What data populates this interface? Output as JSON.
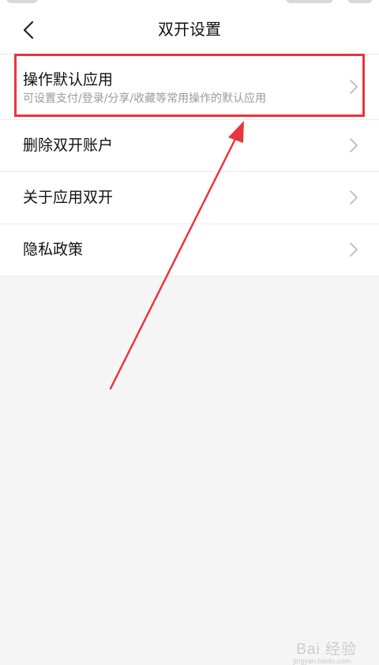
{
  "header": {
    "title": "双开设置",
    "back_icon": "chevron-left-icon"
  },
  "settings": {
    "items": [
      {
        "label": "操作默认应用",
        "sublabel": "可设置支付/登录/分享/收藏等常用操作的默认应用",
        "icon": "chevron-right-icon"
      },
      {
        "label": "删除双开账户",
        "icon": "chevron-right-icon"
      },
      {
        "label": "关于应用双开",
        "icon": "chevron-right-icon"
      },
      {
        "label": "隐私政策",
        "icon": "chevron-right-icon"
      }
    ]
  },
  "annotation": {
    "color": "#e8353d"
  },
  "watermark": {
    "text": "Bai 经验",
    "sub": "jingyan.baidu.com"
  },
  "colors": {
    "background": "#f5f5f5",
    "surface": "#ffffff",
    "divider": "#ececec",
    "text_primary": "#111111",
    "text_secondary": "#9a9a9a",
    "chevron": "#b8b8b8"
  }
}
